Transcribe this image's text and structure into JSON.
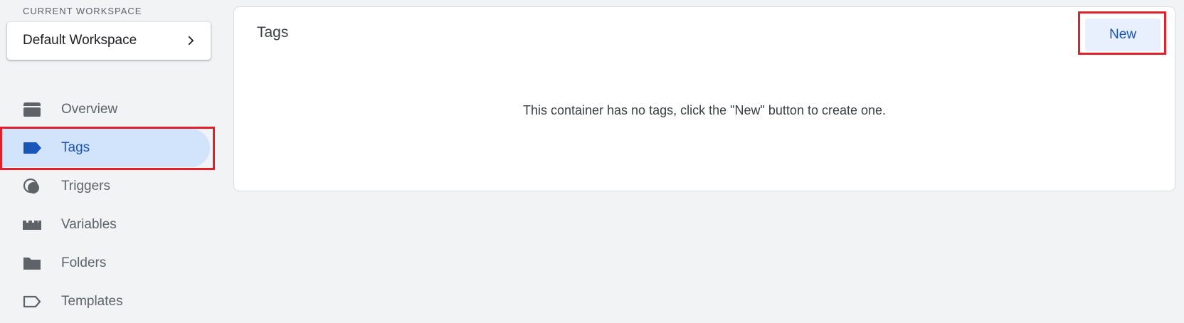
{
  "sidebar": {
    "workspace_caption": "CURRENT WORKSPACE",
    "workspace_name": "Default Workspace",
    "workspace_icon": "chevron-right-icon",
    "items": [
      {
        "label": "Overview",
        "icon": "overview-icon",
        "active": false
      },
      {
        "label": "Tags",
        "icon": "tag-icon",
        "active": true
      },
      {
        "label": "Triggers",
        "icon": "trigger-icon",
        "active": false
      },
      {
        "label": "Variables",
        "icon": "variables-icon",
        "active": false
      },
      {
        "label": "Folders",
        "icon": "folder-icon",
        "active": false
      },
      {
        "label": "Templates",
        "icon": "template-icon",
        "active": false
      }
    ]
  },
  "main": {
    "title": "Tags",
    "new_button_label": "New",
    "empty_message": "This container has no tags, click the \"New\" button to create one."
  },
  "colors": {
    "background": "#f1f3f4",
    "active_bg": "#d2e3fc",
    "accent": "#1a56b8",
    "icon_gray": "#5f6368",
    "highlight": "#e0202a",
    "button_bg": "#e8f0fe"
  }
}
